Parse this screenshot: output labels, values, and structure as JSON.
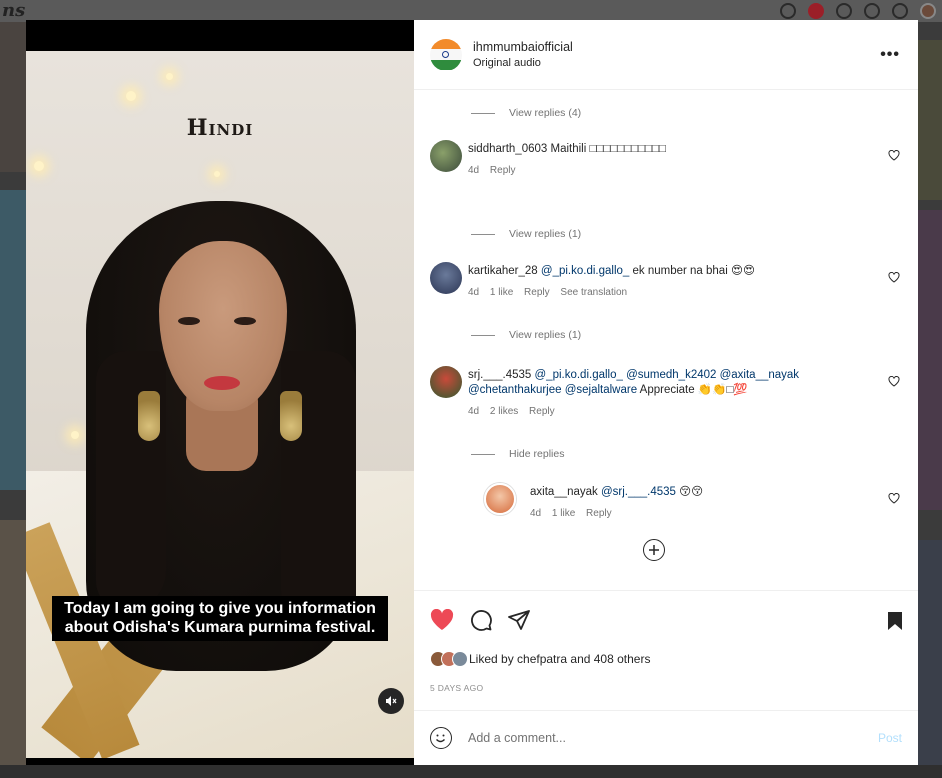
{
  "background": {
    "logo_text": "ns"
  },
  "video": {
    "title": "Hindi",
    "subtitle": "Today I am going to give you information about Odisha's Kumara purnima festival.",
    "mute_icon": "speaker-muted-icon"
  },
  "post": {
    "username": "ihmmumbaiofficial",
    "audio": "Original audio",
    "more": "•••"
  },
  "comments": {
    "view_replies_1": "View replies (4)",
    "c1": {
      "user": "siddharth_0603",
      "text": "Maithili □□□□□□□□□□□",
      "time": "4d",
      "reply": "Reply"
    },
    "view_replies_2": "View replies (1)",
    "c2": {
      "user": "kartikaher_28",
      "mention": "@_pi.ko.di.gallo_",
      "text": "ek number na bhai 😍😍",
      "time": "4d",
      "likes": "1 like",
      "reply": "Reply",
      "translation": "See translation"
    },
    "view_replies_3": "View replies (1)",
    "c3": {
      "user": "srj.___.4535",
      "mentions": "@_pi.ko.di.gallo_ @sumedh_k2402 @axita__nayak @chetanthakurjee @sejaltalware",
      "text": "Appreciate 👏👏□💯",
      "time": "4d",
      "likes": "2 likes",
      "reply": "Reply"
    },
    "hide_replies": "Hide replies",
    "c4": {
      "user": "axita__nayak",
      "mention": "@srj.___.4535",
      "text": "😚😚",
      "time": "4d",
      "likes": "1 like",
      "reply": "Reply"
    },
    "load_more": "⊕"
  },
  "actions": {
    "liked_by": "Liked by chefpatra and 408 others",
    "date": "5 DAYS AGO",
    "like_color": "#ed4956"
  },
  "composer": {
    "placeholder": "Add a comment...",
    "post": "Post"
  }
}
